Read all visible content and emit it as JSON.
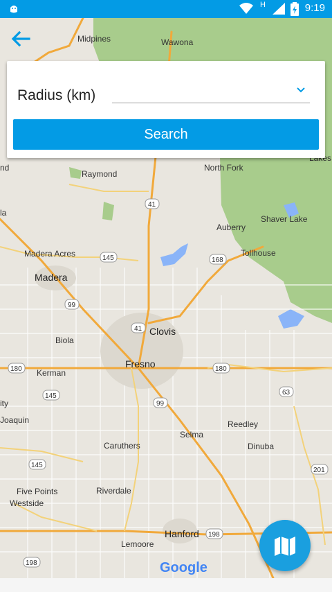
{
  "status_bar": {
    "time": "9:19",
    "network_type": "H"
  },
  "form": {
    "radius_label": "Radius (km)",
    "radius_value": "",
    "search_label": "Search"
  },
  "map": {
    "attribution": "Google",
    "places": {
      "midpines": "Midpines",
      "wawona": "Wawona",
      "raymond": "Raymond",
      "north_fork": "North Fork",
      "lakes": "Lakes",
      "shaver_lake": "Shaver Lake",
      "auberry": "Auberry",
      "tollhouse": "Tollhouse",
      "madera_acres": "Madera Acres",
      "madera": "Madera",
      "clovis": "Clovis",
      "biola": "Biola",
      "fresno": "Fresno",
      "kerman": "Kerman",
      "city_partial": "ity",
      "san_joaquin_partial": "Joaquin",
      "reedley": "Reedley",
      "selma": "Selma",
      "caruthers": "Caruthers",
      "dinuba": "Dinuba",
      "five_points": "Five Points",
      "westside": "Westside",
      "riverdale": "Riverdale",
      "hanford": "Hanford",
      "lemoore": "Lemoore",
      "nd_partial": "nd",
      "la_partial": "la"
    },
    "routes": {
      "r41a": "41",
      "r41b": "41",
      "r145a": "145",
      "r145b": "145",
      "r145c": "145",
      "r168": "168",
      "r99a": "99",
      "r99b": "99",
      "r180a": "180",
      "r180b": "180",
      "r63": "63",
      "r201": "201",
      "r198a": "198",
      "r198b": "198"
    }
  },
  "colors": {
    "status_bar": "#039be5",
    "button": "#039be5",
    "fab": "#1a9fdf",
    "forest": "#a8cc8c",
    "highway": "#f1a93b"
  }
}
